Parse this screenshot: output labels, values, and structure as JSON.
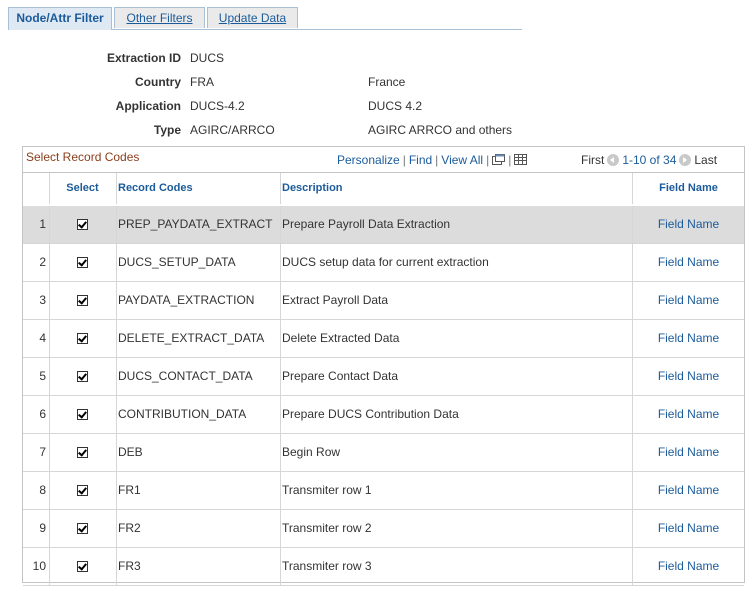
{
  "tabs": [
    {
      "label": "Node/Attr Filter"
    },
    {
      "label": "Other Filters"
    },
    {
      "label": "Update Data"
    }
  ],
  "header": {
    "extraction_id_label": "Extraction ID",
    "extraction_id_value": "DUCS",
    "country_label": "Country",
    "country_code": "FRA",
    "country_desc": "France",
    "application_label": "Application",
    "application_code": "DUCS-4.2",
    "application_desc": "DUCS 4.2",
    "type_label": "Type",
    "type_code": "AGIRC/ARRCO",
    "type_desc": "AGIRC ARRCO and others"
  },
  "grid": {
    "title": "Select Record Codes",
    "personalize": "Personalize",
    "find": "Find",
    "view_all": "View All",
    "first": "First",
    "range": "1-10 of 34",
    "last": "Last",
    "columns": {
      "select": "Select",
      "record_codes": "Record Codes",
      "description": "Description",
      "field_name": "Field Name"
    },
    "rows": [
      {
        "num": "1",
        "code": "PREP_PAYDATA_EXTRACT",
        "desc": "Prepare Payroll Data Extraction",
        "link": "Field Name",
        "checked": true
      },
      {
        "num": "2",
        "code": "DUCS_SETUP_DATA",
        "desc": "DUCS setup data for current extraction",
        "link": "Field Name",
        "checked": true
      },
      {
        "num": "3",
        "code": "PAYDATA_EXTRACTION",
        "desc": "Extract Payroll Data",
        "link": "Field Name",
        "checked": true
      },
      {
        "num": "4",
        "code": "DELETE_EXTRACT_DATA",
        "desc": "Delete Extracted Data",
        "link": "Field Name",
        "checked": true
      },
      {
        "num": "5",
        "code": "DUCS_CONTACT_DATA",
        "desc": "Prepare Contact Data",
        "link": "Field Name",
        "checked": true
      },
      {
        "num": "6",
        "code": "CONTRIBUTION_DATA",
        "desc": "Prepare DUCS Contribution Data",
        "link": "Field Name",
        "checked": true
      },
      {
        "num": "7",
        "code": "DEB",
        "desc": "Begin Row",
        "link": "Field Name",
        "checked": true
      },
      {
        "num": "8",
        "code": "FR1",
        "desc": "Transmiter row 1",
        "link": "Field Name",
        "checked": true
      },
      {
        "num": "9",
        "code": "FR2",
        "desc": "Transmiter row 2",
        "link": "Field Name",
        "checked": true
      },
      {
        "num": "10",
        "code": "FR3",
        "desc": "Transmiter row 3",
        "link": "Field Name",
        "checked": true
      }
    ]
  },
  "icons": {
    "zoom": "new-window-icon",
    "download": "spreadsheet-icon",
    "prev": "previous-arrow-icon",
    "next": "next-arrow-icon"
  }
}
